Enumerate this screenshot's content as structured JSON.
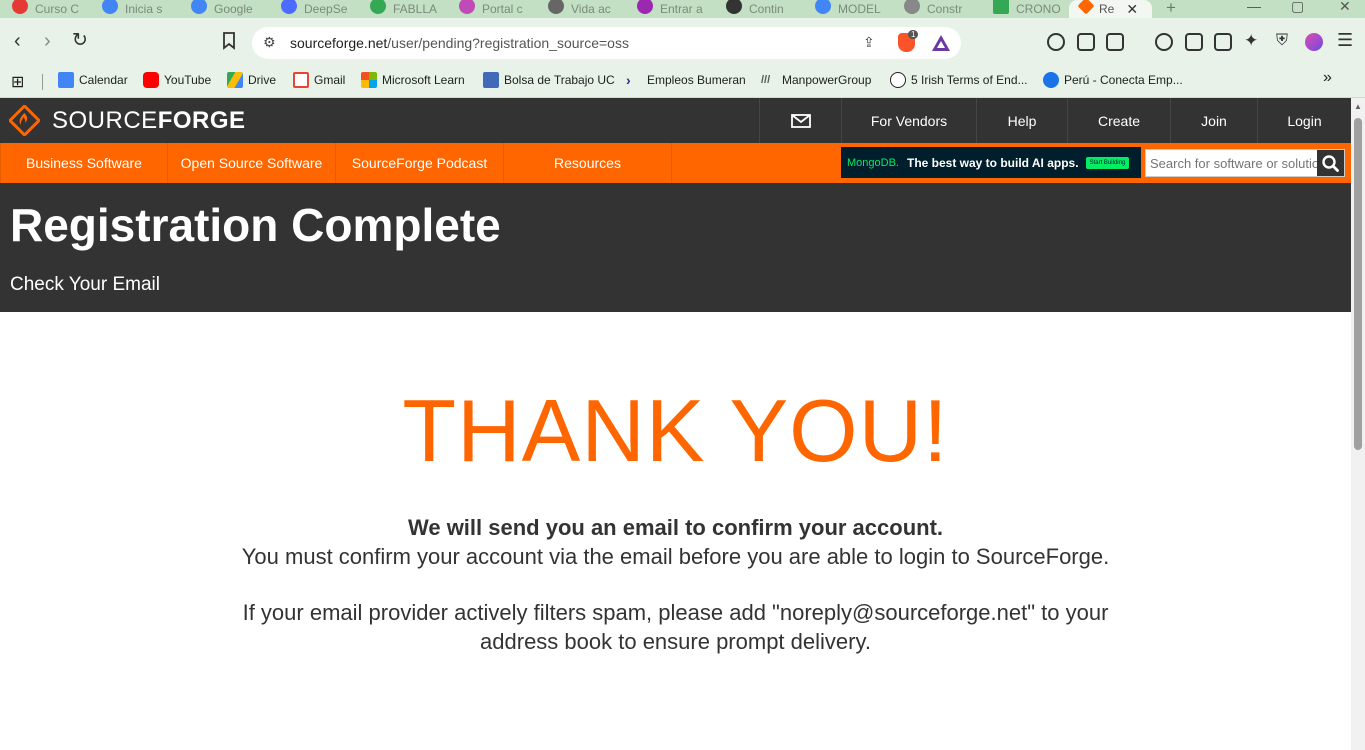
{
  "browser": {
    "tabs": [
      {
        "title": "Curso C",
        "color": "#e53935"
      },
      {
        "title": "Inicia s",
        "color": "#4285f4"
      },
      {
        "title": "Google",
        "color": "#4285f4"
      },
      {
        "title": "DeepSe",
        "color": "#4d6bfe"
      },
      {
        "title": "FABLLA",
        "color": "#34a853"
      },
      {
        "title": "Portal c",
        "color": "#c04ab8"
      },
      {
        "title": "Vida ac",
        "color": "#666666"
      },
      {
        "title": "Entrar a",
        "color": "#9c27b0"
      },
      {
        "title": "Contin",
        "color": "#333333"
      },
      {
        "title": "MODEL",
        "color": "#4285f4"
      },
      {
        "title": "Constr",
        "color": "#888888"
      },
      {
        "title": "CRONO",
        "color": "#34a853"
      },
      {
        "title": "Re",
        "color": "#ff6600"
      }
    ],
    "new_tab": "+",
    "url_host": "sourceforge.net",
    "url_path": "/user/pending?registration_source=oss",
    "shields_count": "1",
    "bookmarks": [
      {
        "label": "Calendar",
        "color": "#4285f4"
      },
      {
        "label": "YouTube",
        "color": "#ff0000"
      },
      {
        "label": "Drive",
        "color": "#34a853"
      },
      {
        "label": "Gmail",
        "color": "#ea4335"
      },
      {
        "label": "Microsoft Learn",
        "color": "#f25022"
      },
      {
        "label": "Bolsa de Trabajo UC",
        "color": "#3f6bb8"
      },
      {
        "label": "Empleos Bumeran",
        "color": "#2b2a8c"
      },
      {
        "label": "ManpowerGroup",
        "color": "#555555"
      },
      {
        "label": "5 Irish Terms of End...",
        "color": "#222222"
      },
      {
        "label": "Perú - Conecta Emp...",
        "color": "#1a73e8"
      }
    ],
    "more_bookmarks": "»"
  },
  "site": {
    "logo_light": "SOURCE",
    "logo_bold": "FORGE",
    "nav": [
      "For Vendors",
      "Help",
      "Create",
      "Join",
      "Login"
    ],
    "categories": [
      "Business Software",
      "Open Source Software",
      "SourceForge Podcast",
      "Resources"
    ],
    "ad": {
      "brand": "MongoDB.",
      "text": "The best way to build AI apps.",
      "cta": "Start Building"
    },
    "search_placeholder": "Search for software or solutions"
  },
  "page": {
    "title": "Registration Complete",
    "subtitle": "Check Your Email",
    "thank_you": "THANK YOU!",
    "line1": "We will send you an email to confirm your account.",
    "line2": "You must confirm your account via the email before you are able to login to SourceForge.",
    "line3": "If your email provider actively filters spam, please add \"noreply@sourceforge.net\" to your",
    "line4": "address book to ensure prompt delivery."
  },
  "colors": {
    "brand_orange": "#ff6600",
    "header_dark": "#333333"
  }
}
